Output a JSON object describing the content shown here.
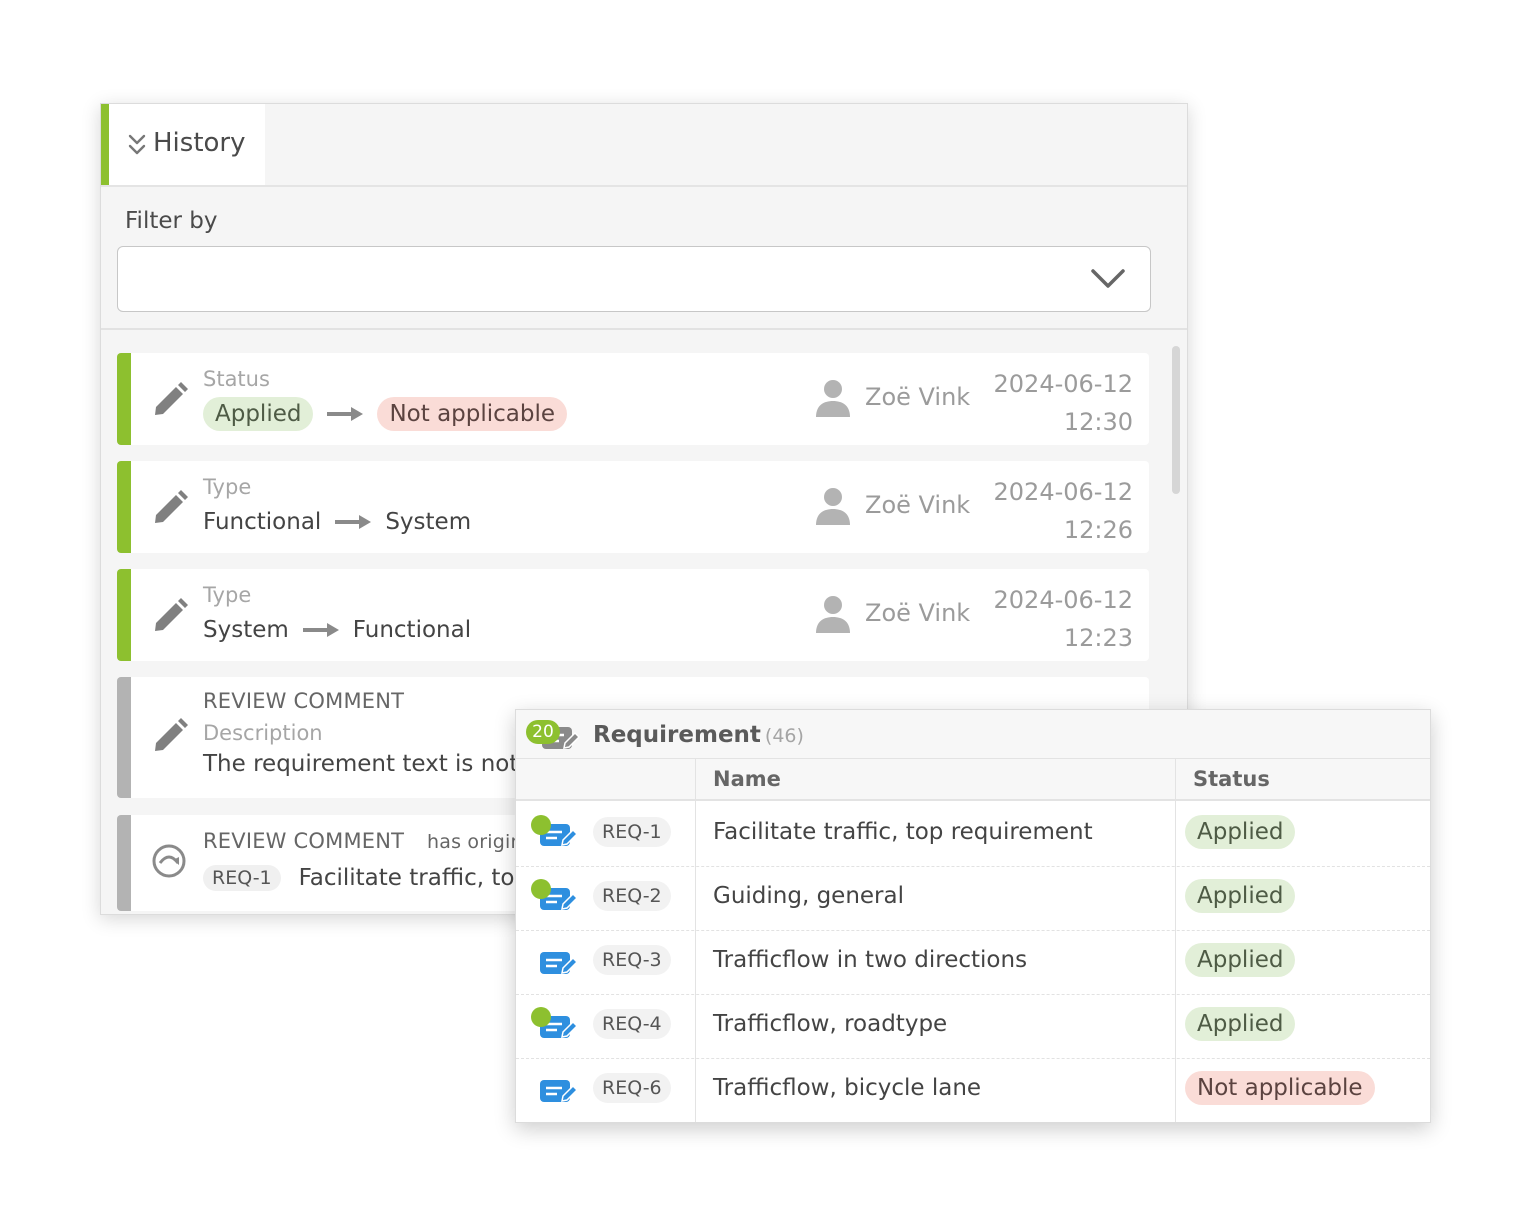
{
  "history": {
    "title": "History",
    "filter_label": "Filter by",
    "filter_value": "",
    "entries": [
      {
        "label": "Status",
        "from": "Applied",
        "to": "Not applicable",
        "user": "Zoë Vink",
        "date": "2024-06-12",
        "time": "12:30"
      },
      {
        "label": "Type",
        "from": "Functional",
        "to": "System",
        "user": "Zoë Vink",
        "date": "2024-06-12",
        "time": "12:26"
      },
      {
        "label": "Type",
        "from": "System",
        "to": "Functional",
        "user": "Zoë Vink",
        "date": "2024-06-12",
        "time": "12:23"
      }
    ],
    "review1": {
      "kind": "REVIEW COMMENT",
      "label": "Description",
      "text": "The requirement text is not"
    },
    "review2": {
      "kind": "REVIEW COMMENT",
      "relation": "has origin",
      "ref": "REQ-1",
      "text": "Facilitate traffic, top"
    }
  },
  "requirements": {
    "badge": "20",
    "title": "Requirement",
    "count": "(46)",
    "col_name": "Name",
    "col_status": "Status",
    "rows": [
      {
        "id": "REQ-1",
        "name": "Facilitate traffic, top requirement",
        "status": "Applied",
        "dot": true
      },
      {
        "id": "REQ-2",
        "name": "Guiding, general",
        "status": "Applied",
        "dot": true
      },
      {
        "id": "REQ-3",
        "name": "Trafficflow in two directions",
        "status": "Applied",
        "dot": false
      },
      {
        "id": "REQ-4",
        "name": "Trafficflow, roadtype",
        "status": "Applied",
        "dot": true
      },
      {
        "id": "REQ-6",
        "name": "Trafficflow, bicycle lane",
        "status": "Not applicable",
        "dot": false
      }
    ]
  },
  "colors": {
    "accent": "#8dc02f",
    "icon_blue": "#2e8fdf",
    "applied_bg": "#e2efd8",
    "not_applicable_bg": "#fadcd7"
  },
  "icons": [
    "double-chevron-down-icon",
    "chevron-down-icon",
    "pencil-icon",
    "user-icon",
    "arrow-right-icon",
    "relation-icon",
    "requirements-icon",
    "requirement-icon"
  ]
}
